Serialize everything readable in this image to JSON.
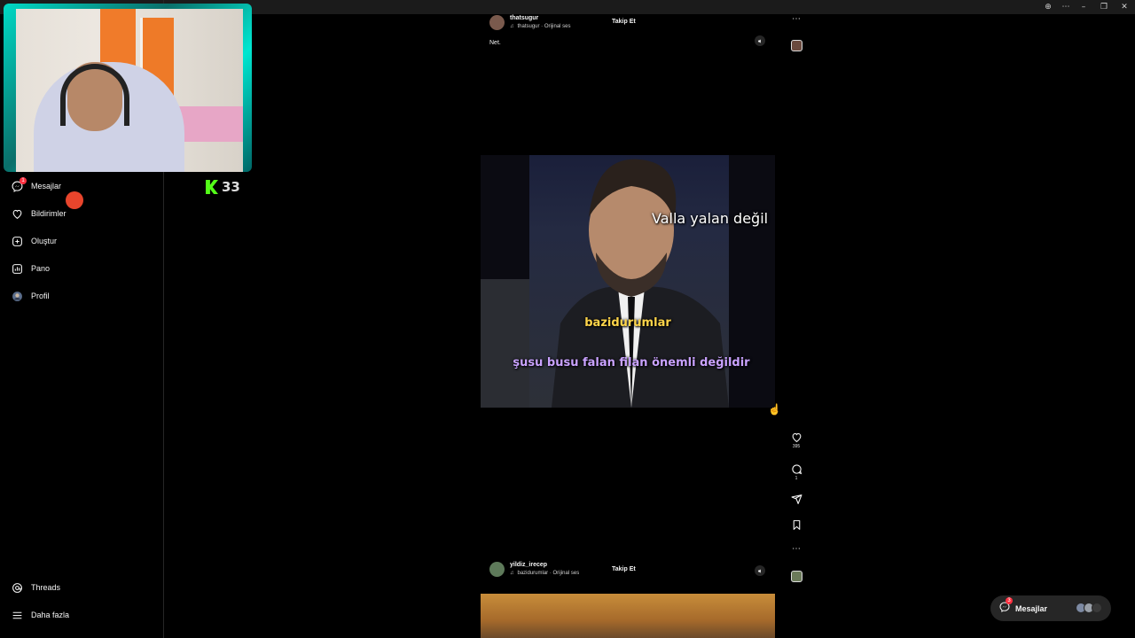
{
  "window": {
    "controls": [
      "⊕",
      "⋯",
      "–",
      "❐",
      "✕"
    ]
  },
  "kick": {
    "count": "33"
  },
  "sidebar": {
    "items": [
      {
        "label": "Mesajlar",
        "badge": "1"
      },
      {
        "label": "Bildirimler"
      },
      {
        "label": "Oluştur"
      },
      {
        "label": "Pano"
      },
      {
        "label": "Profil"
      }
    ],
    "bottom": [
      {
        "label": "Threads"
      },
      {
        "label": "Daha fazla"
      }
    ]
  },
  "posts": [
    {
      "username": "thatsugur",
      "audio": "thatsugur · Orijinal ses",
      "follow_label": "Takip Et",
      "caption": "Net.",
      "subtitles": {
        "top": "Valla yalan değil",
        "middle": "bazidurumlar",
        "bottom": "şusu busu falan filan önemli değildir"
      },
      "likes": "395",
      "comments": "1"
    },
    {
      "username": "yildiz_irecep",
      "audio": "bazidurumlar · Orijinal ses",
      "follow_label": "Takip Et"
    }
  ],
  "messages_bar": {
    "label": "Mesajlar",
    "badge": "3"
  },
  "colors": {
    "background": "#000000",
    "badge": "#ff3040",
    "kick_green": "#53fc18",
    "subtitle_yellow": "#ffd54a",
    "subtitle_purple": "#c9a2ff"
  }
}
